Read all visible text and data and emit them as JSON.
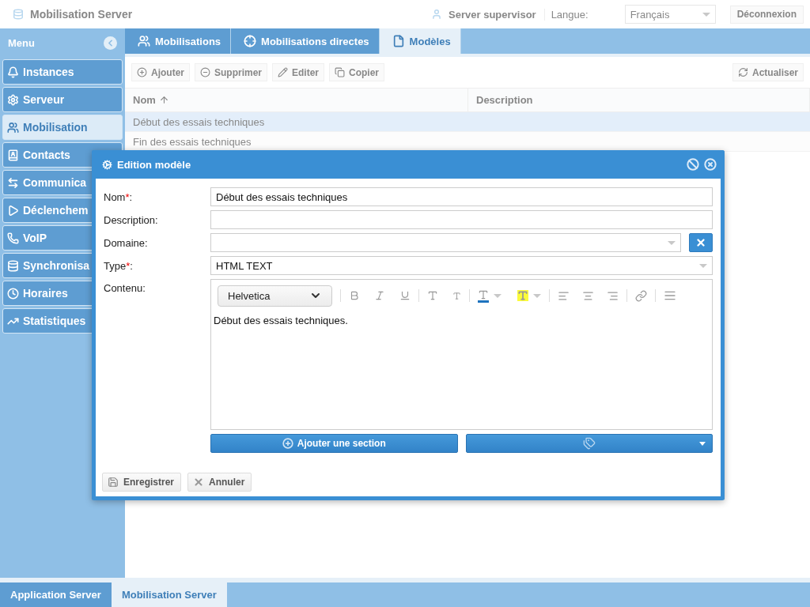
{
  "header": {
    "title": "Mobilisation Server",
    "user": "Server supervisor",
    "language_label": "Langue:",
    "language": "Français",
    "logout": "Déconnexion"
  },
  "sidebar": {
    "title": "Menu",
    "items": [
      {
        "label": "Instances",
        "selected": false
      },
      {
        "label": "Serveur",
        "selected": false
      },
      {
        "label": "Mobilisation",
        "selected": true
      },
      {
        "label": "Contacts",
        "selected": false
      },
      {
        "label": "Communica",
        "selected": false
      },
      {
        "label": "Déclenchem",
        "selected": false
      },
      {
        "label": "VoIP",
        "selected": false
      },
      {
        "label": "Synchronisa",
        "selected": false
      },
      {
        "label": "Horaires",
        "selected": false
      },
      {
        "label": "Statistiques",
        "selected": false
      }
    ]
  },
  "tabs": [
    {
      "label": "Mobilisations",
      "selected": false
    },
    {
      "label": "Mobilisations directes",
      "selected": false
    },
    {
      "label": "Modèles",
      "selected": true
    }
  ],
  "toolbar": {
    "buttons": [
      "Ajouter",
      "Supprimer",
      "Editer",
      "Copier"
    ],
    "refresh": "Actualiser"
  },
  "table": {
    "columns": [
      {
        "label": "Nom",
        "sorted": true
      },
      {
        "label": "Description",
        "sorted": false
      }
    ],
    "rows": [
      {
        "cells": [
          "Début des essais techniques"
        ],
        "selected": true
      },
      {
        "cells": [
          "Fin des essais techniques"
        ],
        "selected": false
      }
    ]
  },
  "dialog": {
    "title": "Edition modèle",
    "fields": [
      {
        "kind": "text",
        "label": "Nom",
        "marker": "*",
        "suffix": ":",
        "value": "Début des essais techniques"
      },
      {
        "kind": "text",
        "label": "Description:"
      },
      {
        "kind": "select",
        "label": "Domaine:",
        "clearable": true
      },
      {
        "kind": "select",
        "label": "Type",
        "marker": "*",
        "suffix": ":",
        "value": "HTML TEXT"
      }
    ],
    "content_label": "Contenu:",
    "font": "Helvetica",
    "content": "Début des essais techniques.",
    "add_section": "Ajouter une section",
    "save": "Enregistrer",
    "cancel": "Annuler"
  },
  "bottom_tabs": [
    {
      "label": "Application Server",
      "selected": false
    },
    {
      "label": "Mobilisation Server",
      "selected": true
    }
  ]
}
